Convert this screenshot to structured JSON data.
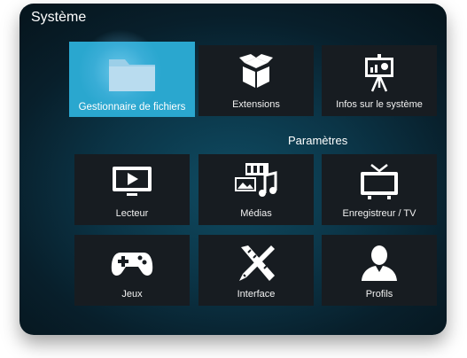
{
  "header": {
    "title": "Système"
  },
  "top_tiles": [
    {
      "label": "Gestionnaire de fichiers",
      "icon": "folder-icon"
    },
    {
      "label": "Extensions",
      "icon": "box-icon"
    },
    {
      "label": "Infos sur le système",
      "icon": "presentation-icon"
    }
  ],
  "settings": {
    "label": "Paramètres",
    "tiles": [
      {
        "label": "Lecteur",
        "icon": "tv-play-icon"
      },
      {
        "label": "Médias",
        "icon": "media-icon"
      },
      {
        "label": "Enregistreur / TV",
        "icon": "tv-icon"
      },
      {
        "label": "Jeux",
        "icon": "gamepad-icon"
      },
      {
        "label": "Interface",
        "icon": "pencil-ruler-icon"
      },
      {
        "label": "Profils",
        "icon": "profile-icon"
      }
    ]
  },
  "colors": {
    "focus": "#2aa7cf",
    "tile": "#171c21",
    "background": "#0b3446"
  }
}
